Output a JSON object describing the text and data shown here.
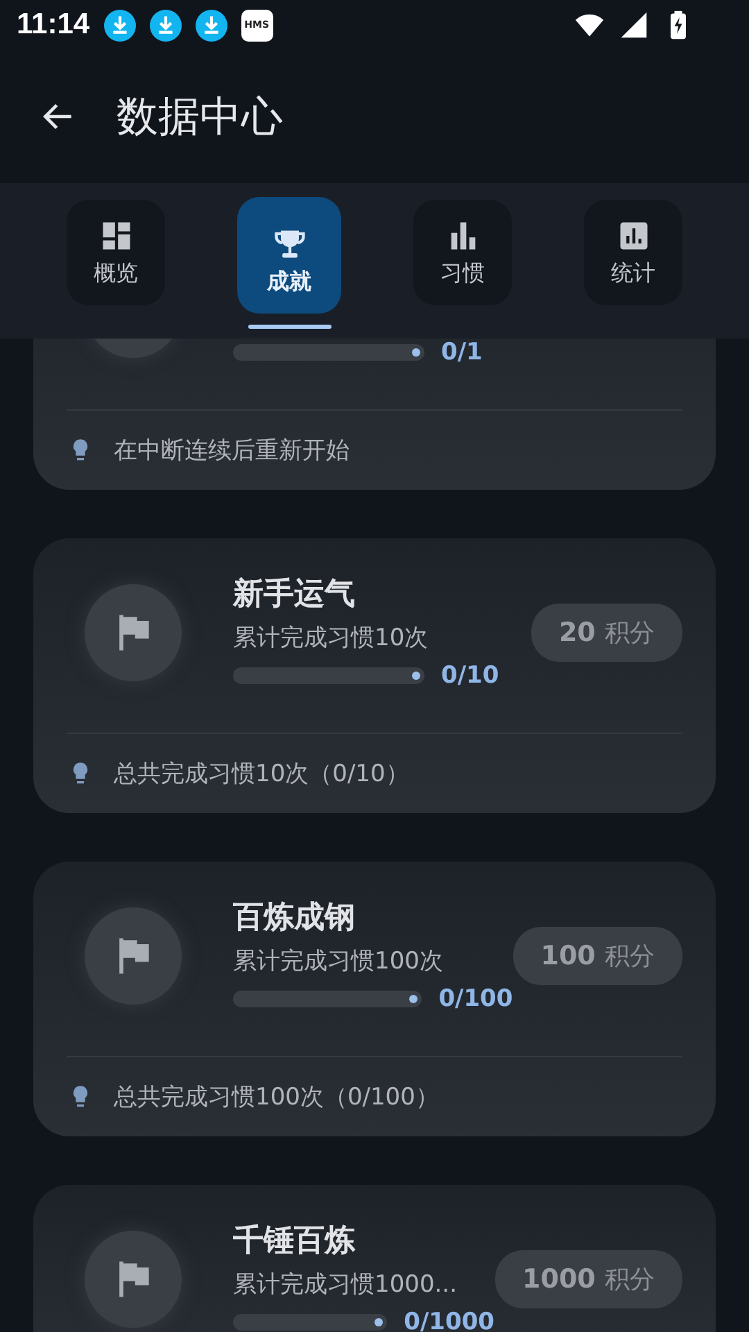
{
  "status_bar": {
    "time": "11:14",
    "notifications": [
      {
        "kind": "download"
      },
      {
        "kind": "download"
      },
      {
        "kind": "download"
      },
      {
        "kind": "app",
        "label": "HMS"
      }
    ]
  },
  "app_bar": {
    "title": "数据中心"
  },
  "tabs": [
    {
      "label": "概览",
      "selected": false
    },
    {
      "label": "成就",
      "selected": true
    },
    {
      "label": "习惯",
      "selected": false
    },
    {
      "label": "统计",
      "selected": false
    }
  ],
  "achievements": [
    {
      "level": 0,
      "progress": "0/1",
      "hint": "在中断连续后重新开始"
    },
    {
      "title": "新手运气",
      "subtitle": "累计完成习惯10次",
      "level": 0,
      "progress": "0/10",
      "points": "20",
      "points_unit": "积分",
      "hint": "总共完成习惯10次（0/10）"
    },
    {
      "title": "百炼成钢",
      "subtitle": "累计完成习惯100次",
      "level": 0,
      "progress": "0/100",
      "points": "100",
      "points_unit": "积分",
      "hint": "总共完成习惯100次（0/100）"
    },
    {
      "title": "千锤百炼",
      "subtitle": "累计完成习惯1000...",
      "level": 0,
      "progress": "0/1000",
      "points": "1000",
      "points_unit": "积分"
    }
  ]
}
